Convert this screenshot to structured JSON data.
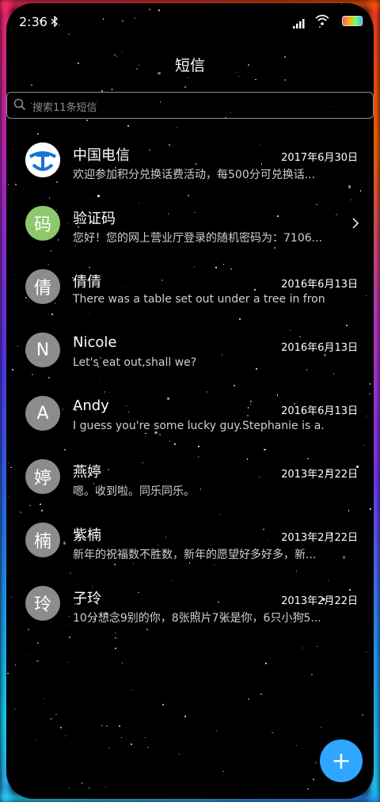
{
  "status_bar": {
    "time": "2:36",
    "icons": [
      "bluetooth-icon",
      "signal-icon",
      "wifi-icon",
      "battery-icon"
    ]
  },
  "header": {
    "title": "短信"
  },
  "search": {
    "placeholder": "搜索11条短信"
  },
  "conversations": [
    {
      "avatar_text": "",
      "avatar_icon": "china-telecom-logo",
      "name": "中国电信",
      "date": "2017年6月30日",
      "preview": "欢迎参加积分兑换话费活动，每500分可兑换话..."
    },
    {
      "avatar_text": "码",
      "avatar_color": "#8dc96c",
      "name": "验证码",
      "date": "",
      "preview": "您好！您的网上营业厅登录的随机密码为：7106...",
      "has_chevron": true
    },
    {
      "avatar_text": "倩",
      "name": "倩倩",
      "date": "2016年6月13日",
      "preview": "There was a table set out under a tree in fron..."
    },
    {
      "avatar_text": "N",
      "name": "Nicole",
      "date": "2016年6月13日",
      "preview": "Let's eat out,shall we?"
    },
    {
      "avatar_text": "A",
      "name": "Andy",
      "date": "2016年6月13日",
      "preview": "I guess you're some lucky guy.Stephanie is a..."
    },
    {
      "avatar_text": "婷",
      "name": "燕婷",
      "date": "2013年2月22日",
      "preview": "嗯。收到啦。同乐同乐。"
    },
    {
      "avatar_text": "楠",
      "name": "紫楠",
      "date": "2013年2月22日",
      "preview": "新年的祝福数不胜数，新年的愿望好多好多，新..."
    },
    {
      "avatar_text": "玲",
      "name": "子玲",
      "date": "2013年2月22日",
      "preview": "10分想念9别的你，8张照片7张是你，6只小狗5..."
    }
  ],
  "fab": {
    "label": "+",
    "icon": "plus-icon"
  },
  "colors": {
    "background": "#000000",
    "fab": "#2fa6ff",
    "avatar_default": "#8c8c8c",
    "avatar_code": "#8dc96c",
    "telecom_blue": "#1473d6"
  }
}
